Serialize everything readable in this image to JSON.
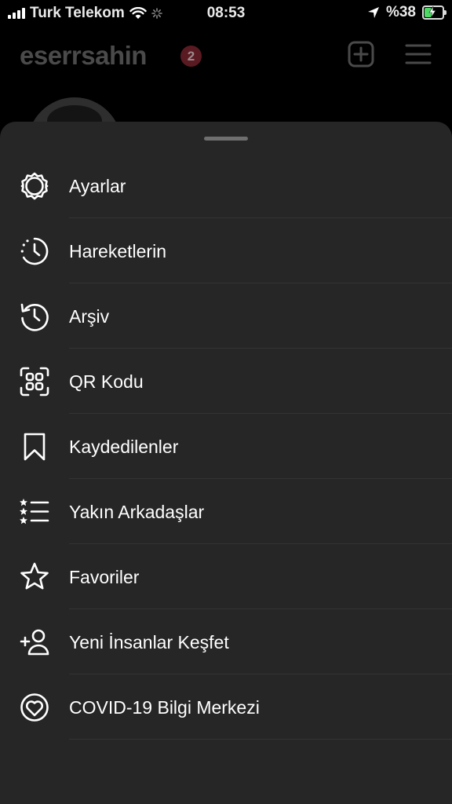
{
  "status_bar": {
    "carrier": "Turk Telekom",
    "time": "08:53",
    "battery": "%38",
    "battery_level": 0.38
  },
  "profile": {
    "username": "eserrsahin",
    "notification_count": "2"
  },
  "menu": {
    "items": [
      {
        "label": "Ayarlar",
        "icon": "settings-gear-icon"
      },
      {
        "label": "Hareketlerin",
        "icon": "activity-clock-icon"
      },
      {
        "label": "Arşiv",
        "icon": "archive-history-icon"
      },
      {
        "label": "QR Kodu",
        "icon": "qr-code-icon"
      },
      {
        "label": "Kaydedilenler",
        "icon": "bookmark-icon"
      },
      {
        "label": "Yakın Arkadaşlar",
        "icon": "close-friends-list-icon"
      },
      {
        "label": "Favoriler",
        "icon": "star-icon"
      },
      {
        "label": "Yeni İnsanlar Keşfet",
        "icon": "add-person-icon"
      },
      {
        "label": "COVID-19 Bilgi Merkezi",
        "icon": "heart-circle-icon"
      }
    ]
  }
}
